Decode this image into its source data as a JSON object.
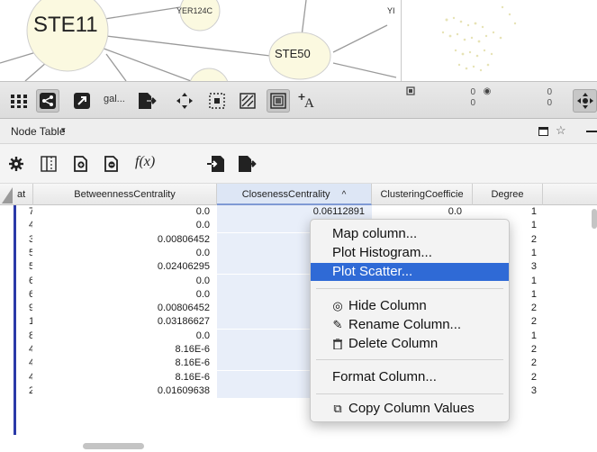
{
  "network": {
    "nodes": [
      "STE11",
      "YER124C",
      "STE50",
      "YI"
    ]
  },
  "toolbar": {
    "style_label": "gal...",
    "selected_nodes": "0",
    "selected_nodes_total": "0",
    "hidden_nodes": "0",
    "hidden_nodes_total": "0",
    "selected_edges": "0",
    "selected_edges_total": "0"
  },
  "panel": {
    "title": "Node Table",
    "caret": "▾",
    "function_label": "f(x)"
  },
  "table": {
    "columns": [
      "at",
      "BetweennessCentrality",
      "ClosenessCentrality",
      "ClusteringCoefficie",
      "Degree"
    ],
    "sort_indicator": "^",
    "rows": [
      [
        "7",
        "0.0",
        "0.06112891",
        "0.0",
        "1"
      ],
      [
        "4",
        "0.0",
        "0.",
        "0.0",
        "1"
      ],
      [
        "3",
        "0.00806452",
        "0.",
        "0.0",
        "2"
      ],
      [
        "5",
        "0.0",
        "0.",
        "",
        "1"
      ],
      [
        "5",
        "0.02406295",
        "0.",
        "",
        "3"
      ],
      [
        "6",
        "0.0",
        "0.",
        "0.0",
        "1"
      ],
      [
        "6",
        "0.0",
        "0.",
        "0.0",
        "1"
      ],
      [
        "9",
        "0.00806452",
        "0.",
        "0.0",
        "2"
      ],
      [
        "1",
        "0.03186627",
        "",
        "",
        "2"
      ],
      [
        "8",
        "0.0",
        "0.",
        "0.0",
        "1"
      ],
      [
        "4",
        "8.16E-6",
        "",
        "0.0",
        "2"
      ],
      [
        "4",
        "8.16E-6",
        "",
        "0.0",
        "2"
      ],
      [
        "4",
        "8.16E-6",
        "",
        "0.0",
        "2"
      ],
      [
        "2",
        "0.01609638",
        "0.07642527",
        "0.0",
        "3"
      ]
    ]
  },
  "context_menu": {
    "items": [
      {
        "label": "Map column...",
        "icon": ""
      },
      {
        "label": "Plot Histogram...",
        "icon": ""
      },
      {
        "label": "Plot Scatter...",
        "icon": "",
        "highlighted": true
      },
      {
        "label": "Hide Column",
        "icon": "eye-slash-icon"
      },
      {
        "label": "Rename Column...",
        "icon": "pencil-icon"
      },
      {
        "label": "Delete Column",
        "icon": "trash-icon"
      },
      {
        "label": "Format Column...",
        "icon": ""
      },
      {
        "label": "Copy Column Values",
        "icon": "copy-icon"
      }
    ]
  },
  "colors": {
    "menu_highlight": "#2f6ad6",
    "sorted_column": "#e8eef9",
    "row_marker": "#2b3aa8",
    "node_fill": "#fbf9e0"
  }
}
